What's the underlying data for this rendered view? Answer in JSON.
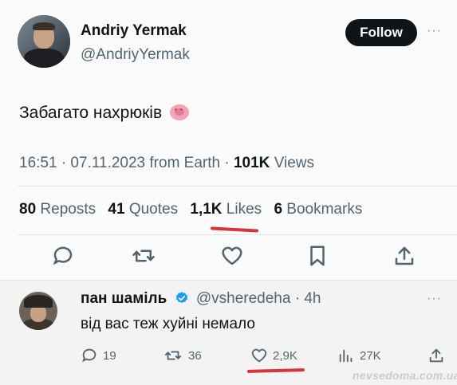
{
  "tweet": {
    "author_name": "Andriy Yermak",
    "author_handle": "@AndriyYermak",
    "follow_label": "Follow",
    "more_label": "···",
    "text": "Забагато нахрюків",
    "emoji": "pig-nose",
    "time": "16:51 · 07.11.2023 from Earth ·",
    "views_count": "101K",
    "views_label": "Views",
    "stats": [
      {
        "count": "80",
        "label": "Reposts"
      },
      {
        "count": "41",
        "label": "Quotes"
      },
      {
        "count": "1,1K",
        "label": "Likes"
      },
      {
        "count": "6",
        "label": "Bookmarks"
      }
    ],
    "actions": [
      "reply-icon",
      "repost-icon",
      "like-icon",
      "bookmark-icon",
      "share-icon"
    ]
  },
  "reply": {
    "author_name": "пан шаміль",
    "author_handle": "@vsheredeha · 4h",
    "more_label": "···",
    "text": "від вас теж хуйні немало",
    "replies": "19",
    "reposts": "36",
    "likes": "2,9K",
    "views": "27K"
  },
  "watermark": "nevsedoma.com.ua",
  "colors": {
    "accent_red": "#d8343b",
    "verified_blue": "#1d9bf0",
    "secondary_text": "#536471"
  }
}
